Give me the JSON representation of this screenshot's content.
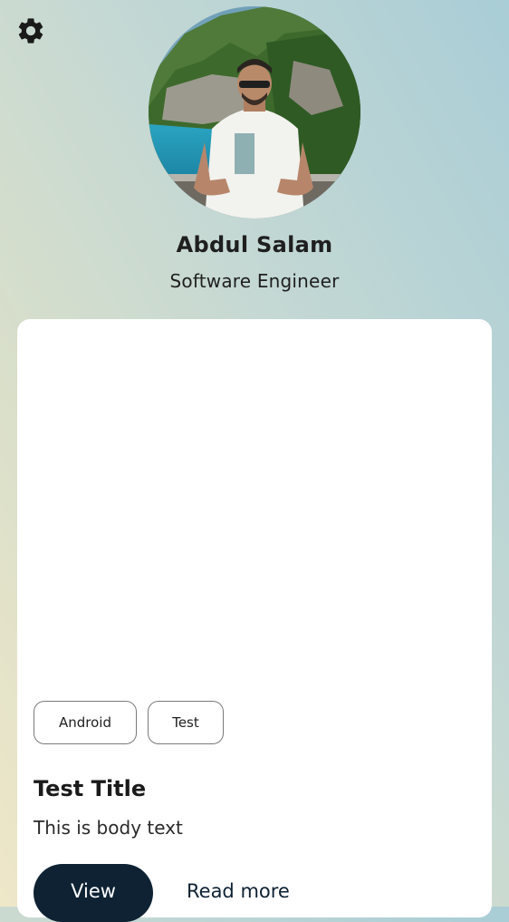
{
  "header": {
    "settings_icon": "gear-icon"
  },
  "profile": {
    "avatar_icon": "profile-photo",
    "name": "Abdul Salam",
    "role": "Software Engineer"
  },
  "card": {
    "chips": [
      {
        "label": "Android"
      },
      {
        "label": "Test"
      }
    ],
    "title": "Test Title",
    "body": "This is body text",
    "primary_button_label": "View",
    "secondary_link_label": "Read more"
  },
  "colors": {
    "primary": "#0e2233",
    "card_background": "#ffffff",
    "chip_border": "#7a7a7a"
  }
}
